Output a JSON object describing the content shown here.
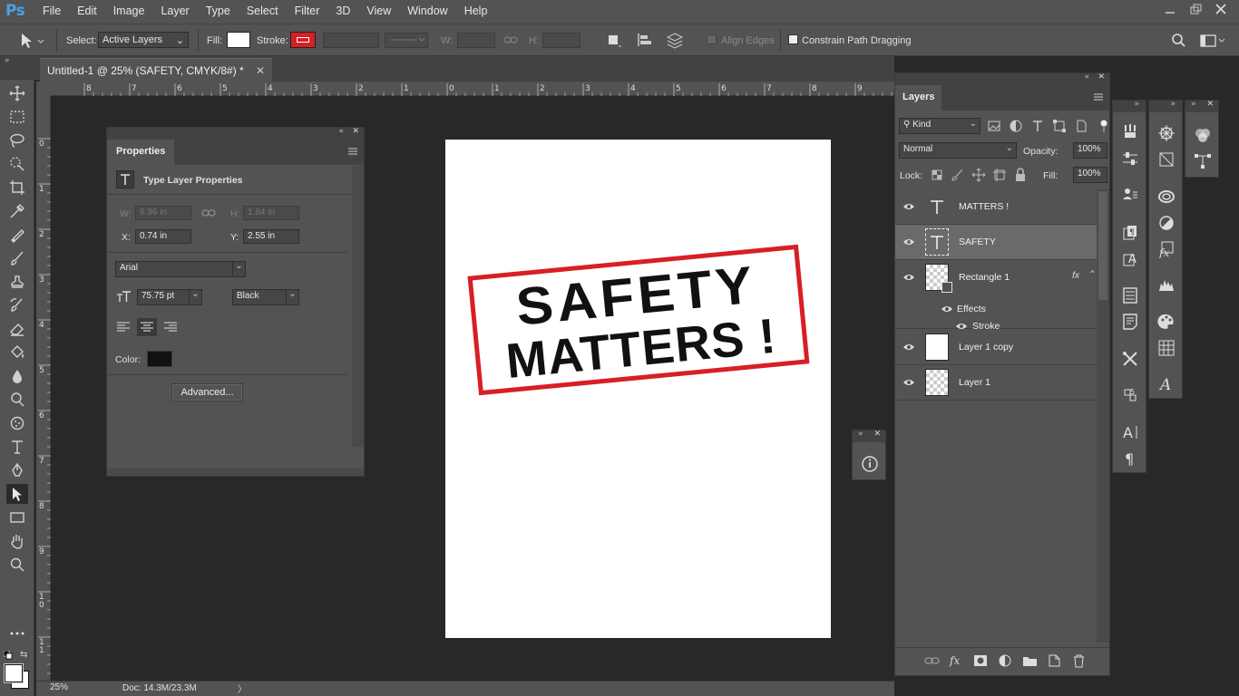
{
  "app": {
    "logo": "Ps"
  },
  "menu": [
    "File",
    "Edit",
    "Image",
    "Layer",
    "Type",
    "Select",
    "Filter",
    "3D",
    "View",
    "Window",
    "Help"
  ],
  "options": {
    "select_label": "Select:",
    "select_value": "Active Layers",
    "fill_label": "Fill:",
    "stroke_label": "Stroke:",
    "w_label": "W:",
    "h_label": "H:",
    "align_edges": "Align Edges",
    "constrain_path": "Constrain Path Dragging",
    "fill_color": "#ffffff",
    "stroke_color": "#d71f26"
  },
  "document": {
    "tab_title": "Untitled-1 @ 25% (SAFETY, CMYK/8#) *",
    "sign_line1": "SAFETY",
    "sign_line2": "MATTERS !",
    "sign_border_color": "#d71f26"
  },
  "rulers": {
    "h_ticks": [
      "8",
      "7",
      "6",
      "5",
      "4",
      "3",
      "2",
      "1",
      "0",
      "1",
      "2",
      "3",
      "4",
      "5",
      "6",
      "7",
      "8",
      "9"
    ],
    "h_ticks_right": [
      "15",
      "16"
    ],
    "v_ticks": [
      "0",
      "1",
      "2",
      "3",
      "4",
      "5",
      "6",
      "7",
      "8",
      "9",
      "1 0",
      "1 1"
    ]
  },
  "status": {
    "zoom": "25%",
    "doc": "Doc: 14.3M/23.3M"
  },
  "properties": {
    "tab": "Properties",
    "heading": "Type Layer Properties",
    "w_label": "W:",
    "w_value": "6.96 in",
    "h_label": "H:",
    "h_value": "1.84 in",
    "x_label": "X:",
    "x_value": "0.74 in",
    "y_label": "Y:",
    "y_value": "2.55 in",
    "font_family": "Arial",
    "font_size": "75.75 pt",
    "font_style": "Black",
    "color_label": "Color:",
    "color_value": "#111111",
    "advanced_button": "Advanced..."
  },
  "layers_panel": {
    "tab": "Layers",
    "filter": "Kind",
    "blend_mode": "Normal",
    "opacity_label": "Opacity:",
    "opacity_value": "100%",
    "lock_label": "Lock:",
    "fill_label": "Fill:",
    "fill_value": "100%",
    "layers": [
      {
        "name": "MATTERS !",
        "kind": "type"
      },
      {
        "name": "SAFETY",
        "kind": "type",
        "selected": true
      },
      {
        "name": "Rectangle 1",
        "kind": "shape",
        "fx": "fx"
      },
      {
        "name": "Layer 1 copy",
        "kind": "white"
      },
      {
        "name": "Layer 1",
        "kind": "transparent"
      }
    ],
    "effects_label": "Effects",
    "stroke_label": "Stroke"
  }
}
